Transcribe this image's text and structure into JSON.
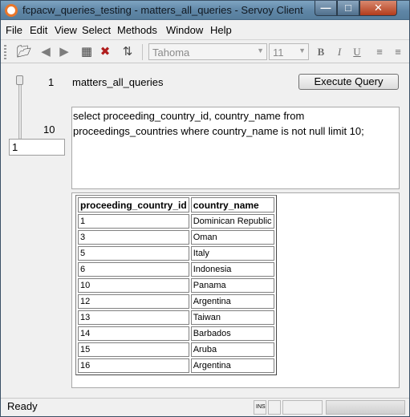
{
  "window": {
    "title": "fcpacw_queries_testing - matters_all_queries - Servoy Client",
    "controls": {
      "minimize": "—",
      "maximize": "□",
      "close": "✕"
    }
  },
  "menu": [
    "File",
    "Edit",
    "View",
    "Select",
    "Methods",
    "Window",
    "Help"
  ],
  "toolbar": {
    "icons": [
      "open-folder-icon",
      "back-arrow-icon",
      "forward-arrow-icon",
      "new-record-icon",
      "delete-record-icon",
      "sort-icon"
    ],
    "font_family": "Tahoma",
    "font_size": "11",
    "format_buttons": {
      "bold": "B",
      "italic": "I",
      "underline": "U"
    }
  },
  "form": {
    "slider": {
      "min": "0",
      "min_label": "1",
      "max_label": "10",
      "value": "1"
    },
    "query_name": "matters_all_queries",
    "execute_button": "Execute Query",
    "sql": "select proceeding_country_id, country_name from\nproceedings_countries where country_name is not null limit 10;"
  },
  "results": {
    "columns": [
      "proceeding_country_id",
      "country_name"
    ],
    "rows": [
      [
        "1",
        "Dominican Republic"
      ],
      [
        "3",
        "Oman"
      ],
      [
        "5",
        "Italy"
      ],
      [
        "6",
        "Indonesia"
      ],
      [
        "10",
        "Panama"
      ],
      [
        "12",
        "Argentina"
      ],
      [
        "13",
        "Taiwan"
      ],
      [
        "14",
        "Barbados"
      ],
      [
        "15",
        "Aruba"
      ],
      [
        "16",
        "Argentina"
      ]
    ]
  },
  "status": {
    "text": "Ready",
    "ins": "INS"
  },
  "colors": {
    "titlebar": "#6b91b1",
    "close_button": "#c0502c",
    "app_icon": "#e9762a"
  }
}
